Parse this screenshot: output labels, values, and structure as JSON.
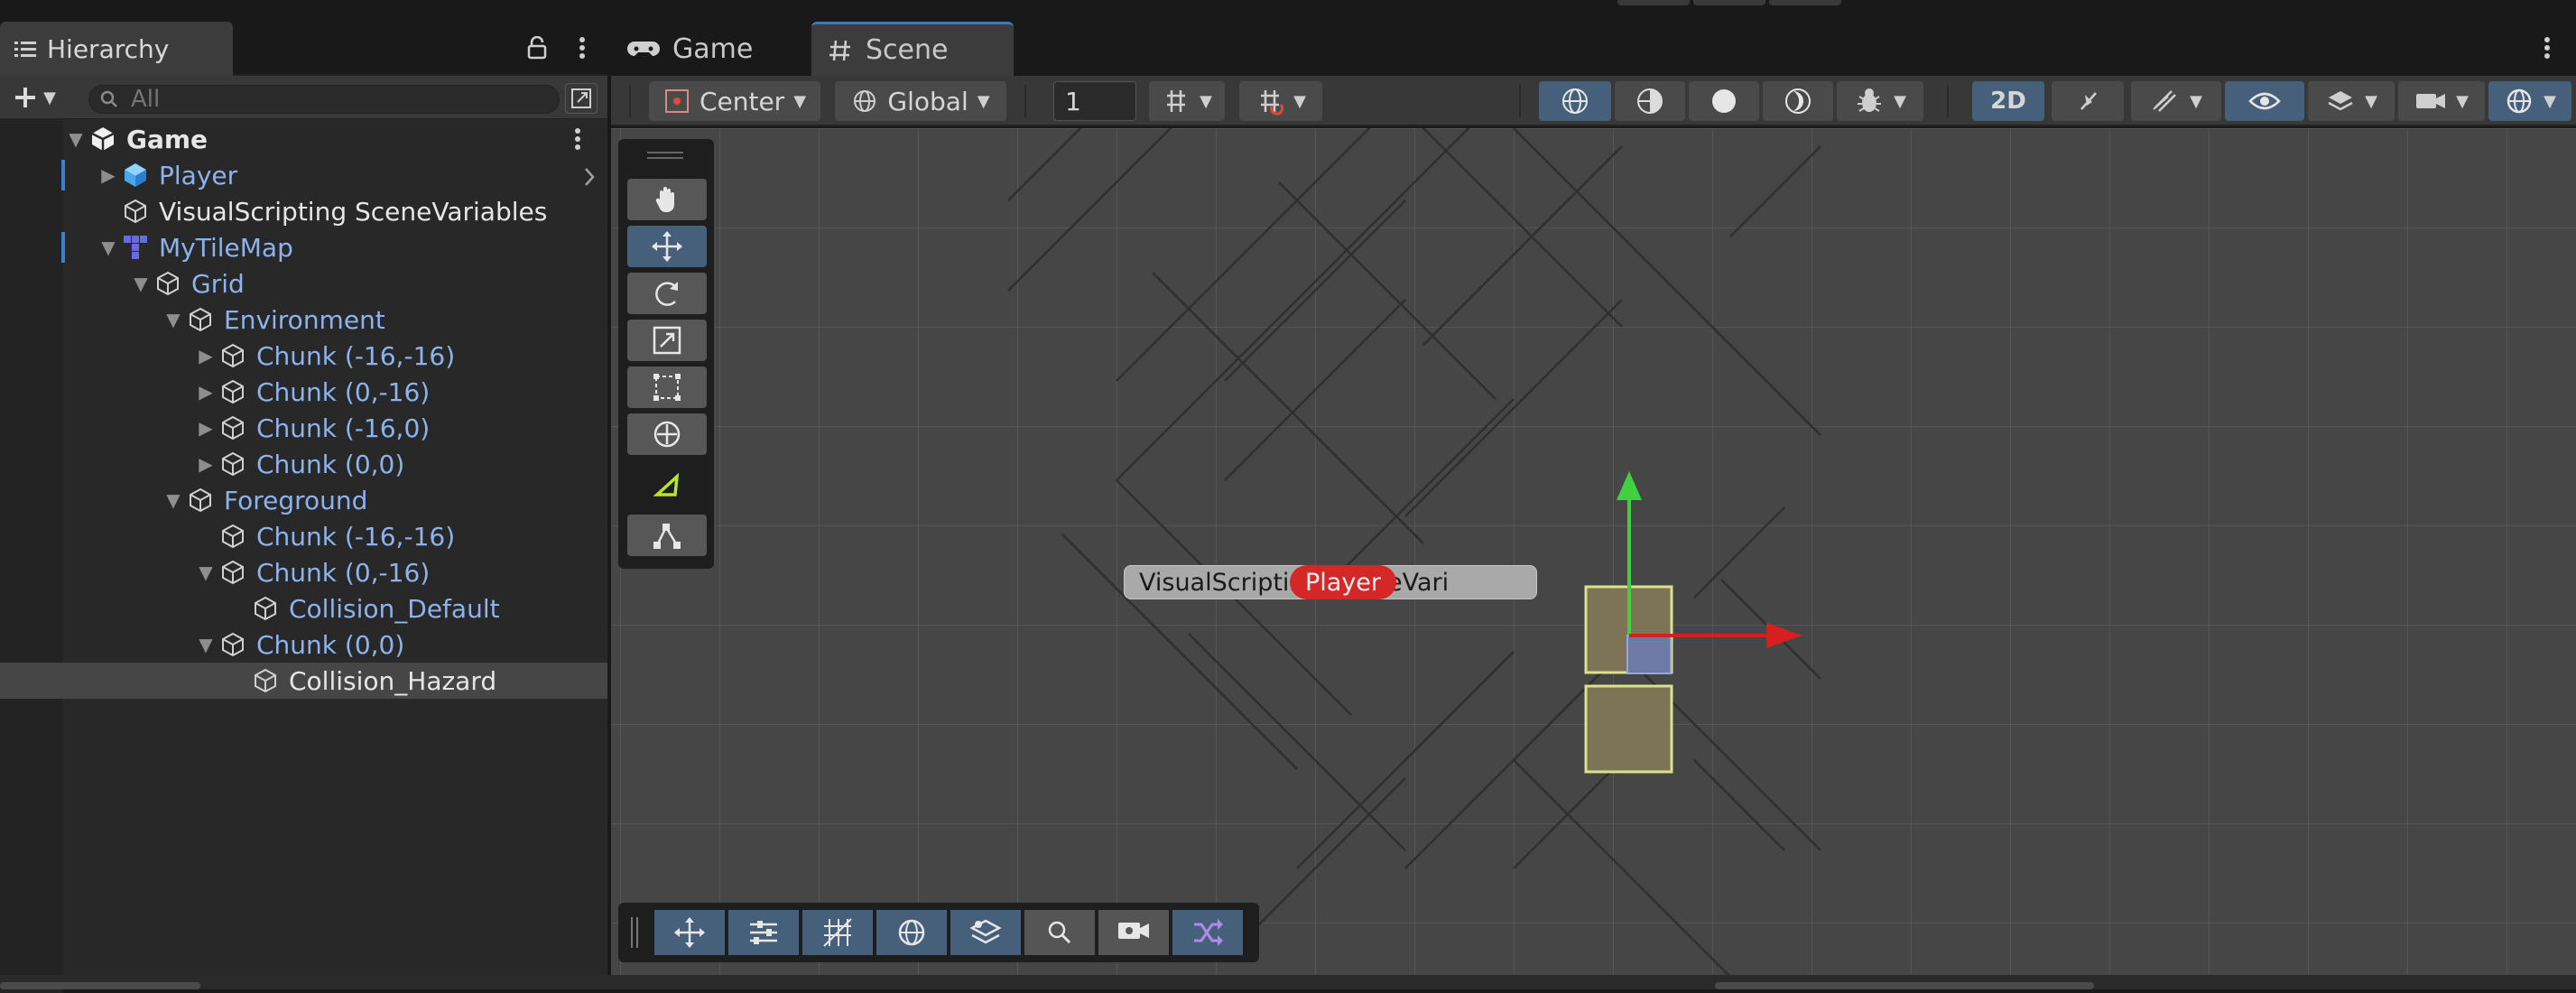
{
  "hierarchy": {
    "tab_label": "Hierarchy",
    "search_placeholder": "All",
    "tree": [
      {
        "label": "Game",
        "depth": 0,
        "expanded": true,
        "kind": "scene",
        "color": "white"
      },
      {
        "label": "Player",
        "depth": 1,
        "expanded": false,
        "kind": "prefab",
        "color": "blue",
        "has_children": true,
        "scene_marker": true
      },
      {
        "label": "VisualScripting SceneVariables",
        "depth": 1,
        "kind": "object",
        "color": "white"
      },
      {
        "label": "MyTileMap",
        "depth": 1,
        "expanded": true,
        "kind": "tilemap",
        "color": "blue",
        "scene_marker": true
      },
      {
        "label": "Grid",
        "depth": 2,
        "expanded": true,
        "kind": "object",
        "color": "blue"
      },
      {
        "label": "Environment",
        "depth": 3,
        "expanded": true,
        "kind": "object",
        "color": "blue"
      },
      {
        "label": "Chunk (-16,-16)",
        "depth": 4,
        "expanded": false,
        "kind": "object",
        "color": "blue",
        "has_children": true
      },
      {
        "label": "Chunk (0,-16)",
        "depth": 4,
        "expanded": false,
        "kind": "object",
        "color": "blue",
        "has_children": true
      },
      {
        "label": "Chunk (-16,0)",
        "depth": 4,
        "expanded": false,
        "kind": "object",
        "color": "blue",
        "has_children": true
      },
      {
        "label": "Chunk (0,0)",
        "depth": 4,
        "expanded": false,
        "kind": "object",
        "color": "blue",
        "has_children": true
      },
      {
        "label": "Foreground",
        "depth": 3,
        "expanded": true,
        "kind": "object",
        "color": "blue"
      },
      {
        "label": "Chunk (-16,-16)",
        "depth": 4,
        "kind": "object",
        "color": "blue"
      },
      {
        "label": "Chunk (0,-16)",
        "depth": 4,
        "expanded": true,
        "kind": "object",
        "color": "blue"
      },
      {
        "label": "Collision_Default",
        "depth": 5,
        "kind": "object",
        "color": "blue"
      },
      {
        "label": "Chunk (0,0)",
        "depth": 4,
        "expanded": true,
        "kind": "object",
        "color": "blue"
      },
      {
        "label": "Collision_Hazard",
        "depth": 5,
        "kind": "object",
        "color": "white",
        "selected": true
      }
    ]
  },
  "scene_view": {
    "tabs": [
      {
        "label": "Game",
        "icon": "gamepad-icon"
      },
      {
        "label": "Scene",
        "icon": "hash-icon",
        "active": true
      }
    ],
    "toolbar": {
      "pivot_label": "Center",
      "space_label": "Global",
      "snap_increment": "1",
      "mode_2d_label": "2D"
    },
    "name_overlay_text": "VisualScripting SceneVari",
    "player_tag_label": "Player"
  },
  "colors": {
    "accent_blue": "#46607c",
    "link_blue": "#8ab3ef",
    "gizmo_x": "#d62020",
    "gizmo_y": "#3fd13f",
    "selection_outline": "#d9e28c"
  }
}
